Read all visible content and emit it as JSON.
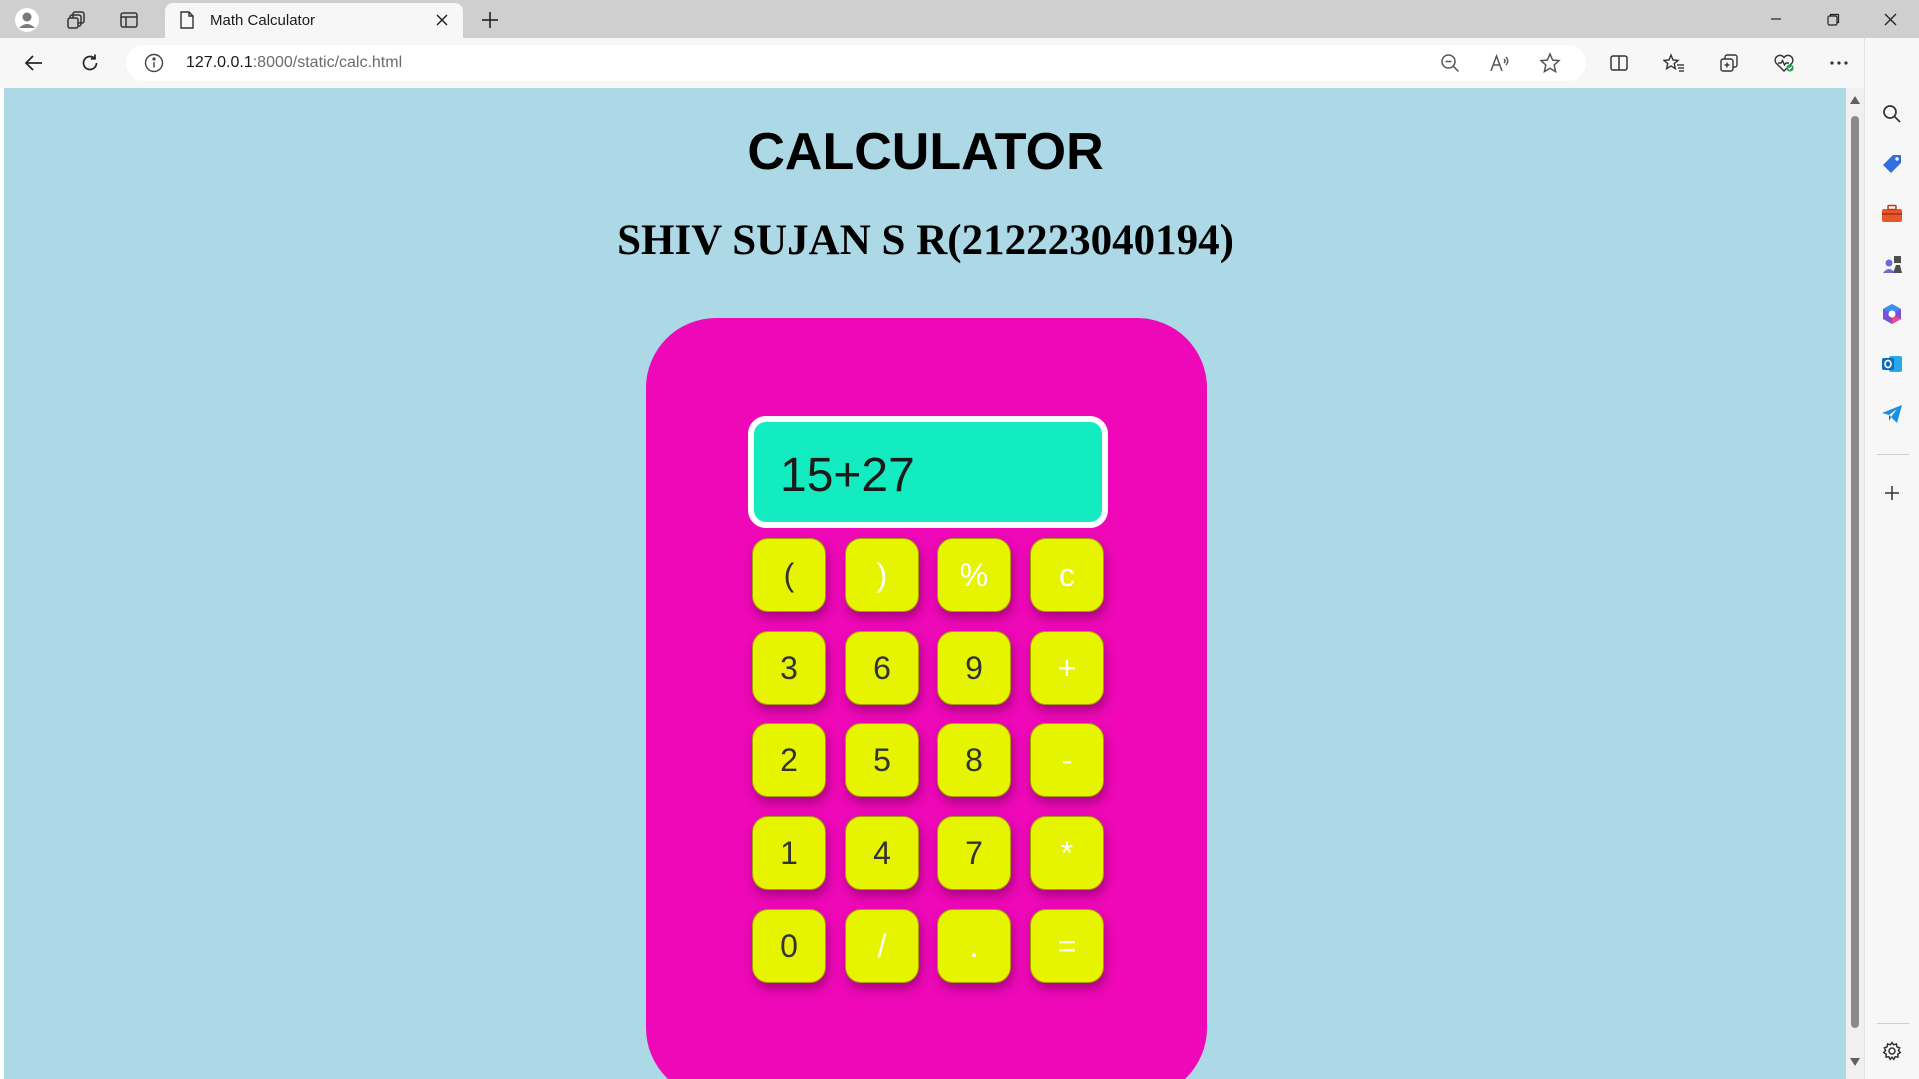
{
  "browser": {
    "tab_title": "Math Calculator",
    "url_host": "127.0.0.1",
    "url_path": ":8000/static/calc.html"
  },
  "page": {
    "title": "CALCULATOR",
    "subtitle": "SHIV SUJAN S R(212223040194)"
  },
  "calculator": {
    "display": "15+27",
    "keys": [
      [
        "(",
        ")",
        "%",
        "c"
      ],
      [
        "3",
        "6",
        "9",
        "+"
      ],
      [
        "2",
        "5",
        "8",
        "-"
      ],
      [
        "1",
        "4",
        "7",
        "*"
      ],
      [
        "0",
        "/",
        ".",
        "="
      ]
    ]
  },
  "colors": {
    "page_background": "#add8e6",
    "calculator_body": "#ee08b8",
    "display_background": "#12ecc0",
    "key_background": "#e6f400"
  },
  "icons": {
    "tabstrip": [
      "profile-icon",
      "workspaces-icon",
      "tab-actions-icon"
    ],
    "toolbar": [
      "back-icon",
      "refresh-icon",
      "site-info-icon",
      "zoom-out-icon",
      "read-aloud-icon",
      "favorite-star-icon",
      "split-screen-icon",
      "favorites-icon",
      "collections-icon",
      "browser-essentials-icon",
      "more-icon",
      "copilot-icon"
    ],
    "sidebar": [
      "search-icon",
      "shopping-icon",
      "tools-icon",
      "games-icon",
      "microsoft365-icon",
      "outlook-icon",
      "telegram-icon",
      "add-icon",
      "settings-icon"
    ]
  }
}
